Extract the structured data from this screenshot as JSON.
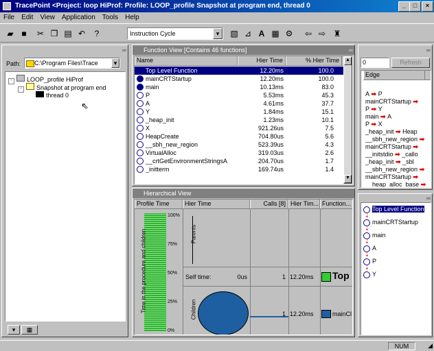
{
  "window": {
    "title": "TracePoint <Project: loop HiProf: Profile: LOOP_profile Snapshot at program end, thread 0"
  },
  "menu": [
    "File",
    "Edit",
    "View",
    "Application",
    "Tools",
    "Help"
  ],
  "toolbar": {
    "metric_select": "Instruction Cycle"
  },
  "left_pane": {
    "path_label": "Path:",
    "path_value": "C:\\Program Files\\Trace",
    "tree": [
      "LOOP_profile HiProf",
      "Snapshot at program end",
      "thread 0"
    ]
  },
  "function_view": {
    "title": "Function View [Contains 46 functions]",
    "columns": [
      "Name",
      "Hier Time",
      "% Hier Time"
    ],
    "rows": [
      {
        "name": "Top Level Function",
        "time": "12.20ms",
        "pct": "100.0"
      },
      {
        "name": "mainCRTStartup",
        "time": "12.20ms",
        "pct": "100.0"
      },
      {
        "name": "main",
        "time": "10.13ms",
        "pct": "83.0"
      },
      {
        "name": "P",
        "time": "5.53ms",
        "pct": "45.3"
      },
      {
        "name": "A",
        "time": "4.61ms",
        "pct": "37.7"
      },
      {
        "name": "Y",
        "time": "1.84ms",
        "pct": "15.1"
      },
      {
        "name": "_heap_init",
        "time": "1.23ms",
        "pct": "10.1"
      },
      {
        "name": "X",
        "time": "921.26us",
        "pct": "7.5"
      },
      {
        "name": "HeapCreate",
        "time": "704.80us",
        "pct": "5.6"
      },
      {
        "name": "__sbh_new_region",
        "time": "523.39us",
        "pct": "4.3"
      },
      {
        "name": "VirtualAlloc",
        "time": "319.03us",
        "pct": "2.6"
      },
      {
        "name": "__crtGetEnvironmentStringsA",
        "time": "204.70us",
        "pct": "1.7"
      },
      {
        "name": "_initterm",
        "time": "169.74us",
        "pct": "1.4"
      }
    ]
  },
  "right_pane": {
    "input_value": "0",
    "refresh_label": "Refresh",
    "edge_header": "Edge",
    "edges": [
      [
        "A",
        "P"
      ],
      [
        "mainCRTStartup",
        ""
      ],
      [
        "P",
        "Y"
      ],
      [
        "main",
        "A"
      ],
      [
        "P",
        "X"
      ],
      [
        "_heap_init",
        "Heap"
      ],
      [
        "__sbh_new_region",
        ""
      ],
      [
        "mainCRTStartup",
        ""
      ],
      [
        "__initstdio",
        "_callo"
      ],
      [
        "_heap_init",
        "_sbl"
      ],
      [
        "__sbh_new_region",
        ""
      ],
      [
        "mainCRTStartup",
        ""
      ],
      [
        "__heap_alloc_base",
        ""
      ]
    ],
    "call_tree": [
      "Top Level Function",
      "mainCRTStartup",
      "main",
      "A",
      "P",
      "Y"
    ]
  },
  "hier_view": {
    "title": "Hierarchical View",
    "columns": [
      "Profile Time",
      "Hier Time",
      "Calls [8]",
      "Hier Tim...",
      "Function..."
    ],
    "vertical_label": "Time in the procedure and children",
    "scale_labels": [
      "100%",
      "75%",
      "50%",
      "25%",
      "0%"
    ],
    "parents_label": "Parents",
    "children_label": "Children",
    "self_time_label": "Self time:",
    "self_time_value": "0us",
    "row1": {
      "calls": "1",
      "time": "12.20ms",
      "func": "Top"
    },
    "row2": {
      "calls": "1",
      "time": "12.20ms",
      "func": "mainCl"
    }
  },
  "status": {
    "num": "NUM"
  }
}
